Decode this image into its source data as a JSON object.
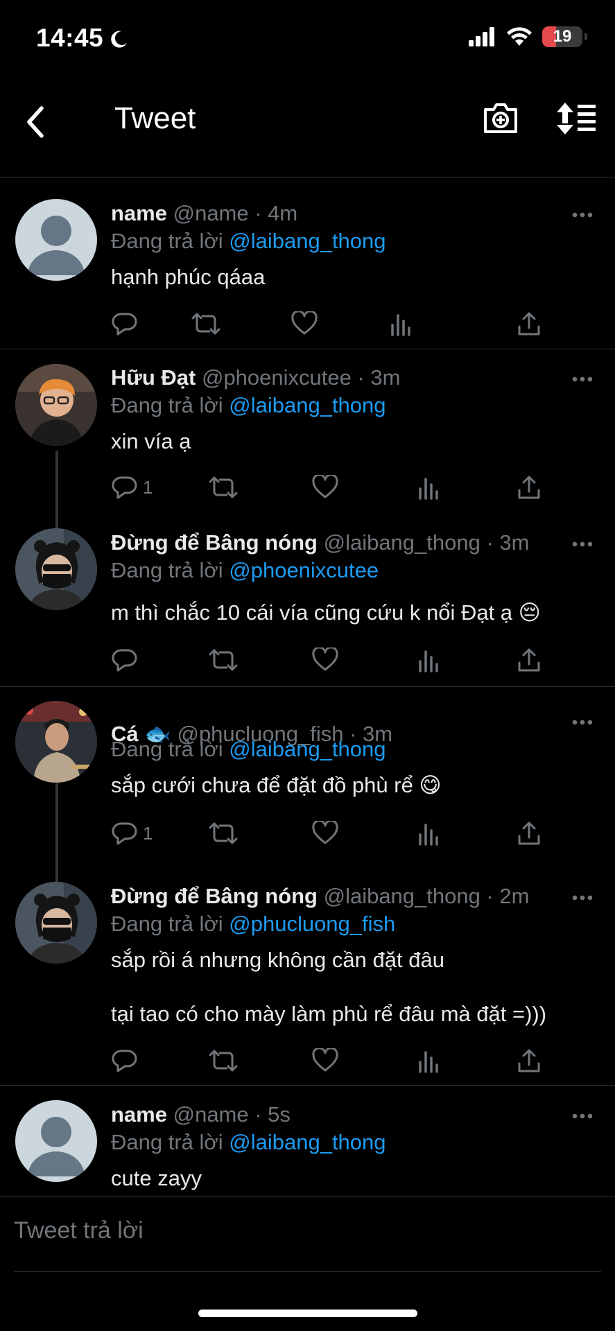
{
  "status_bar": {
    "time": "14:45",
    "battery": "19"
  },
  "header": {
    "title": "Tweet"
  },
  "tweets": [
    {
      "name": "name",
      "handle": "@name · 4m",
      "reply_prefix": "Đang trả lời",
      "reply_to": "@laibang_thong",
      "text": "hạnh phúc qáaa",
      "reply_count": ""
    },
    {
      "name": "Hữu Đạt",
      "handle": "@phoenixcutee · 3m",
      "reply_prefix": "Đang trả lời",
      "reply_to": "@laibang_thong",
      "text": "xin vía ạ",
      "reply_count": "1"
    },
    {
      "name": "Đừng để Bâng nóng",
      "handle": "@laibang_thong · 3m",
      "reply_prefix": "Đang trả lời",
      "reply_to": "@phoenixcutee",
      "text": "m thì chắc 10 cái vía cũng cứu k nổi Đạt ạ 😔",
      "reply_count": ""
    },
    {
      "name": "Cá 🐟",
      "handle": "@phucluong_fish · 3m",
      "reply_prefix": "Đang trả lời",
      "reply_to": "@laibang_thong",
      "text": "sắp cưới chưa để đặt đồ phù rể 😋",
      "reply_count": "1"
    },
    {
      "name": "Đừng để Bâng nóng",
      "handle": "@laibang_thong · 2m",
      "reply_prefix": "Đang trả lời",
      "reply_to": "@phucluong_fish",
      "text": "sắp rồi á nhưng không cần đặt đâu",
      "text2": "tại tao có cho mày làm phù rể đâu mà đặt =)))",
      "reply_count": ""
    },
    {
      "name": "name",
      "handle": "@name · 5s",
      "reply_prefix": "Đang trả lời",
      "reply_to": "@laibang_thong",
      "text": "cute zayy"
    }
  ],
  "reply_bar": {
    "placeholder": "Tweet trả lời"
  },
  "colors": {
    "background": "#000000",
    "accent": "#1d9bf0",
    "muted": "#71767b",
    "text": "#e7e9ea"
  }
}
